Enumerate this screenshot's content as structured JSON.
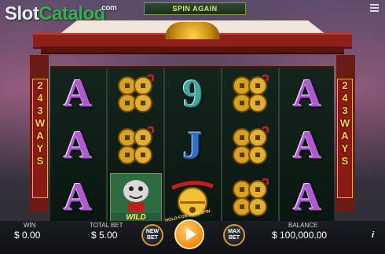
{
  "watermark": {
    "brand_a": "Slot",
    "brand_b": "Catalog",
    "suffix": ".com"
  },
  "banner": {
    "message": "SPIN AGAIN"
  },
  "ways": {
    "left_text": [
      "2",
      "4",
      "3",
      "W",
      "A",
      "Y",
      "S"
    ],
    "right_text": [
      "2",
      "4",
      "3",
      "W",
      "A",
      "Y",
      "S"
    ]
  },
  "reels": [
    [
      "A",
      "A",
      "A"
    ],
    [
      "coins-symbol",
      "coins-symbol",
      "wild-symbol"
    ],
    [
      "9",
      "J",
      "golden-bell-symbol"
    ],
    [
      "coins-symbol",
      "coins-symbol",
      "coins-symbol"
    ],
    [
      "A",
      "A",
      "A"
    ]
  ],
  "wild": {
    "label": "WILD"
  },
  "hold_label": "HOLD FOR AUTOSPIN",
  "footer": {
    "win_label": "WIN",
    "win_value": "$ 0.00",
    "total_bet_label": "TOTAL BET",
    "total_bet_value": "$ 5.00",
    "new_bet_line1": "NEW",
    "new_bet_line2": "BET",
    "max_bet_line1": "MAX",
    "max_bet_line2": "BET",
    "balance_label": "BALANCE",
    "balance_value": "$ 100,000.00",
    "info": "i"
  },
  "colors": {
    "accent_gold": "#d59a2c",
    "spin_orange": "#f08a12",
    "banner_green": "#d8e27a"
  }
}
